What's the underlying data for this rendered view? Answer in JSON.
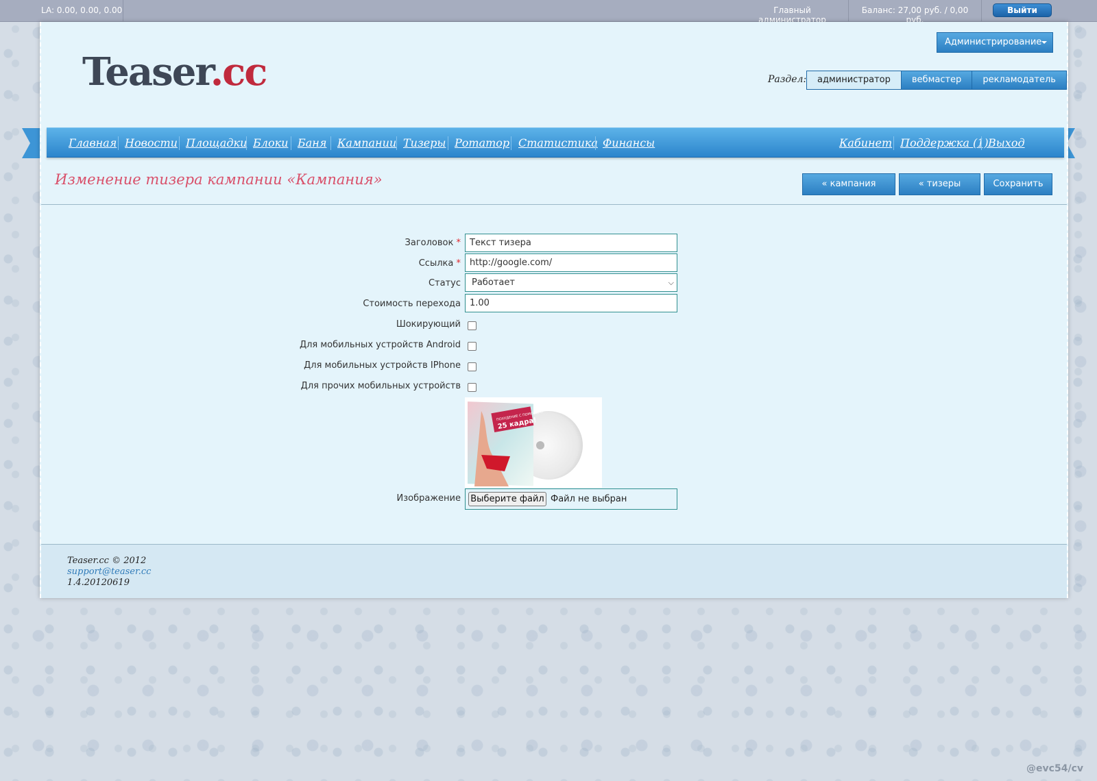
{
  "topbar": {
    "la": "LA: 0.00, 0.00, 0.00",
    "user": "Главный администратор",
    "balance": "Баланс: 27,00 руб. / 0,00 руб.",
    "logout": "Выйти"
  },
  "header": {
    "logo_main": "Teaser",
    "logo_suffix": ".cc",
    "admin_menu": "Администрирование",
    "section_label": "Раздел:",
    "sections": [
      {
        "label": "администратор",
        "active": true
      },
      {
        "label": "вебмастер",
        "active": false
      },
      {
        "label": "рекламодатель",
        "active": false
      }
    ]
  },
  "nav": {
    "left": [
      "Главная",
      "Новости",
      "Площадки",
      "Блоки",
      "Баня",
      "Кампании",
      "Тизеры",
      "Ротатор",
      "Статистика",
      "Финансы"
    ],
    "right": [
      "Кабинет",
      "Поддержка (1)",
      "Выход"
    ]
  },
  "page": {
    "title": "Изменение тизера кампании «Кампания»",
    "buttons": {
      "campaign": "« кампания",
      "teasers": "« тизеры",
      "save": "Сохранить"
    }
  },
  "form": {
    "title_label": "Заголовок",
    "title_value": "Текст тизера",
    "link_label": "Ссылка",
    "link_value": "http://google.com/",
    "status_label": "Статус",
    "status_value": "Работает",
    "cost_label": "Стоимость перехода",
    "cost_value": "1.00",
    "shocking_label": "Шокирующий",
    "android_label": "Для мобильных устройств Android",
    "iphone_label": "Для мобильных устройств IPhone",
    "other_label": "Для прочих мобильных устройств",
    "image_label": "Изображение",
    "image_caption_1": "ПОХУДЕНИЕ С ПОМОЩЬЮ",
    "image_caption_2": "25 кадра!",
    "file_button": "Выберите файл",
    "file_status": "Файл не выбран",
    "required_mark": "*"
  },
  "footer": {
    "copyright": "Teaser.cc © 2012",
    "email": "support@teaser.cc",
    "version": "1.4.20120619"
  },
  "watermark": "@evc54/cv",
  "colors": {
    "accent_blue": "#2c85cc",
    "title_pink": "#d9506a",
    "page_bg": "#e4f4fb"
  }
}
